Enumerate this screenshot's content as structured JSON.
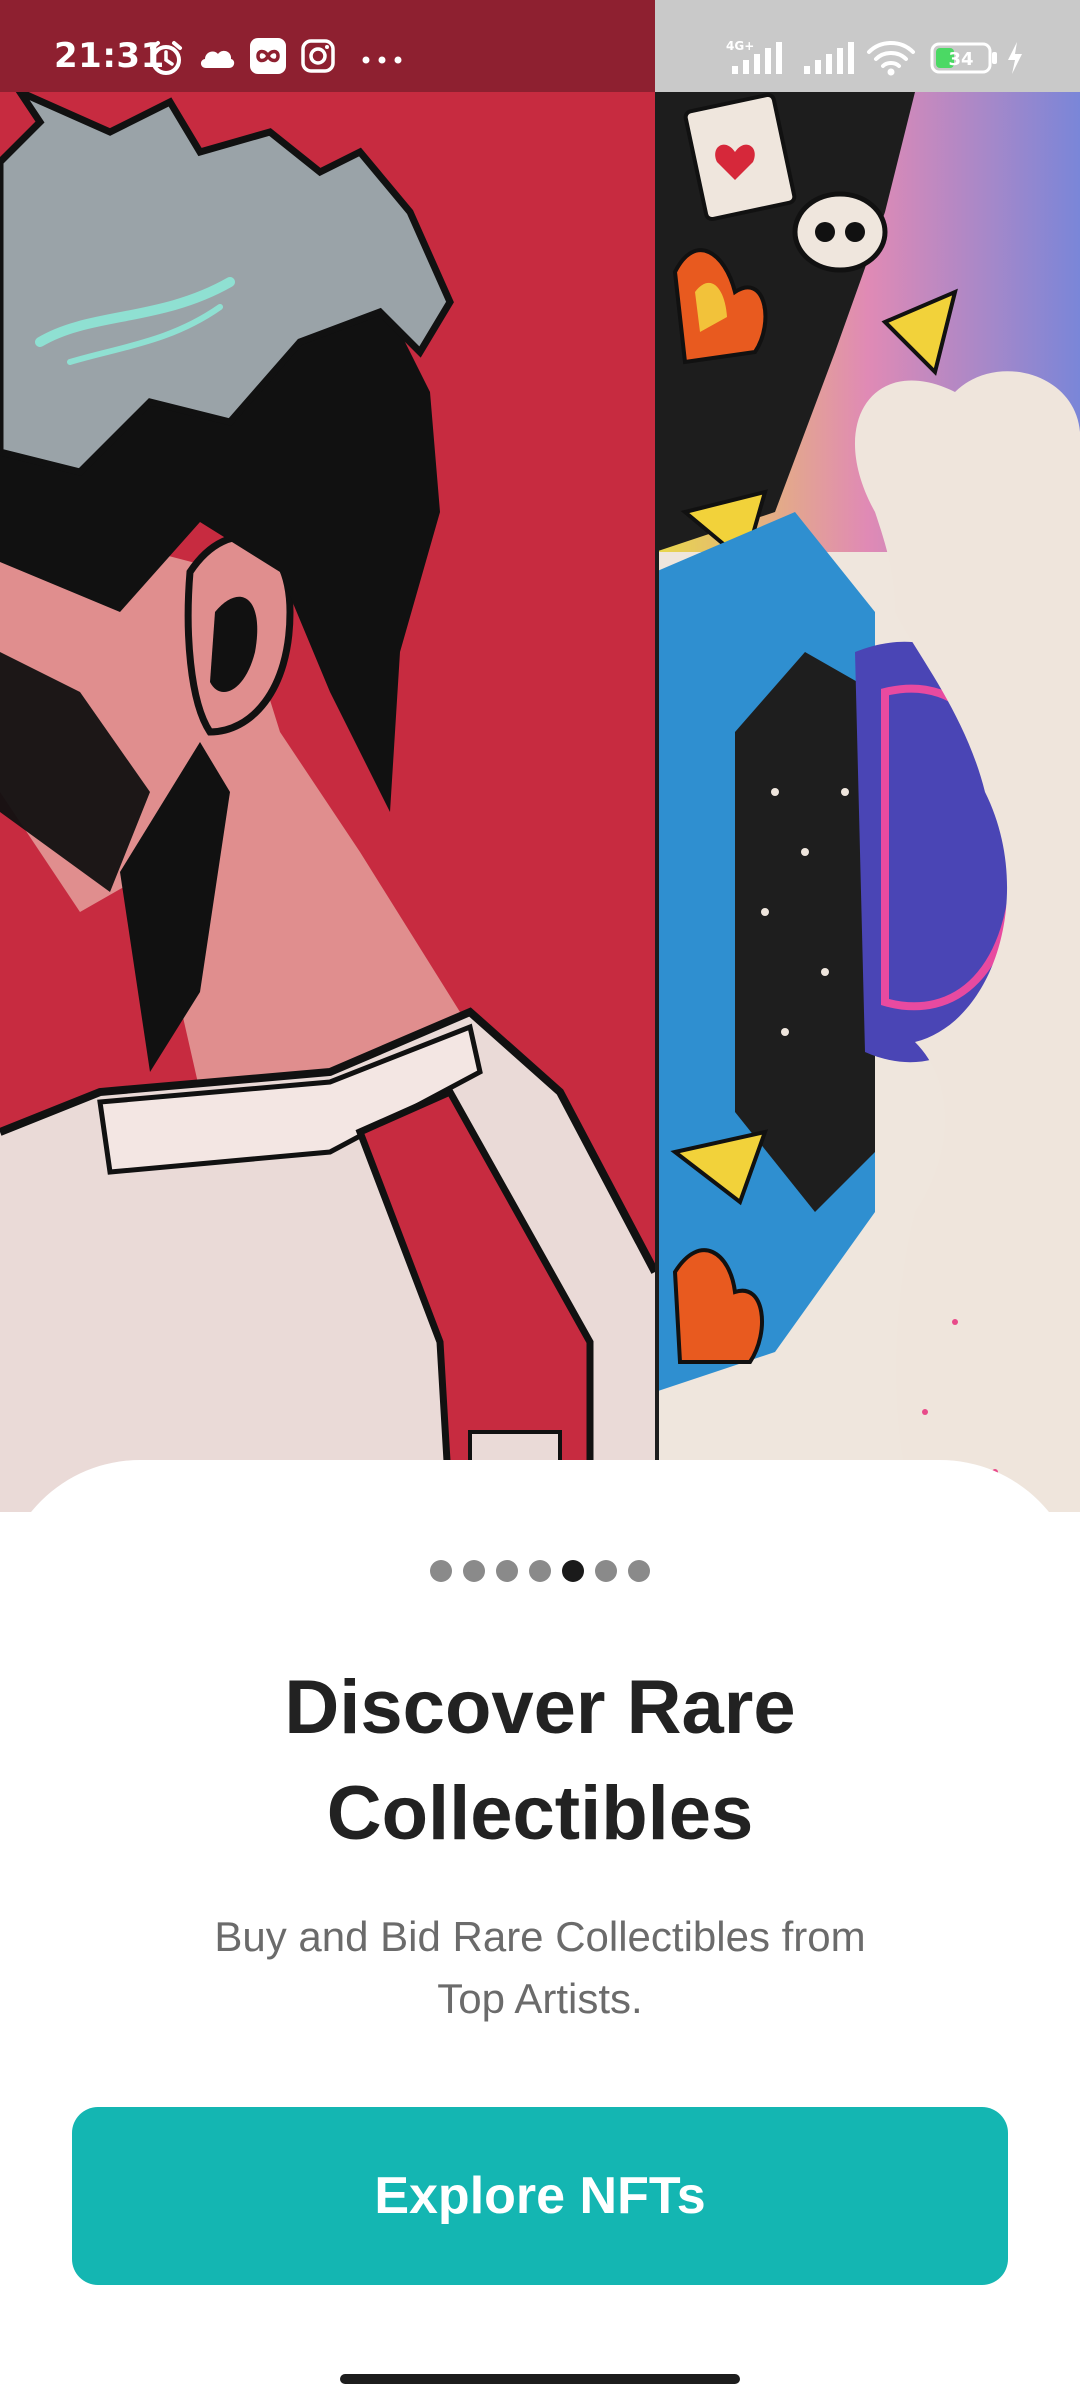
{
  "status_bar": {
    "time": "21:31",
    "network": "4G+",
    "battery": "34",
    "icons": [
      "alarm-icon",
      "cloud-icon",
      "infinity-app-icon",
      "instagram-icon",
      "more-dots-icon",
      "signal-icon",
      "signal-icon",
      "wifi-icon",
      "battery-icon",
      "charging-icon"
    ]
  },
  "pager": {
    "count": 7,
    "active_index": 4
  },
  "onboarding": {
    "title_line1": "Discover Rare",
    "title_line2": "Collectibles",
    "subtitle_line1": "Buy and Bid Rare Collectibles from",
    "subtitle_line2": "Top Artists.",
    "cta_label": "Explore NFTs"
  },
  "colors": {
    "status_bar": "#8e2030",
    "left_art_bg": "#c72b40",
    "accent": "#14b6b2",
    "title": "#222222",
    "subtitle": "#6b6b6b",
    "dot_inactive": "#8a8a8a",
    "dot_active": "#1a1a1a"
  }
}
